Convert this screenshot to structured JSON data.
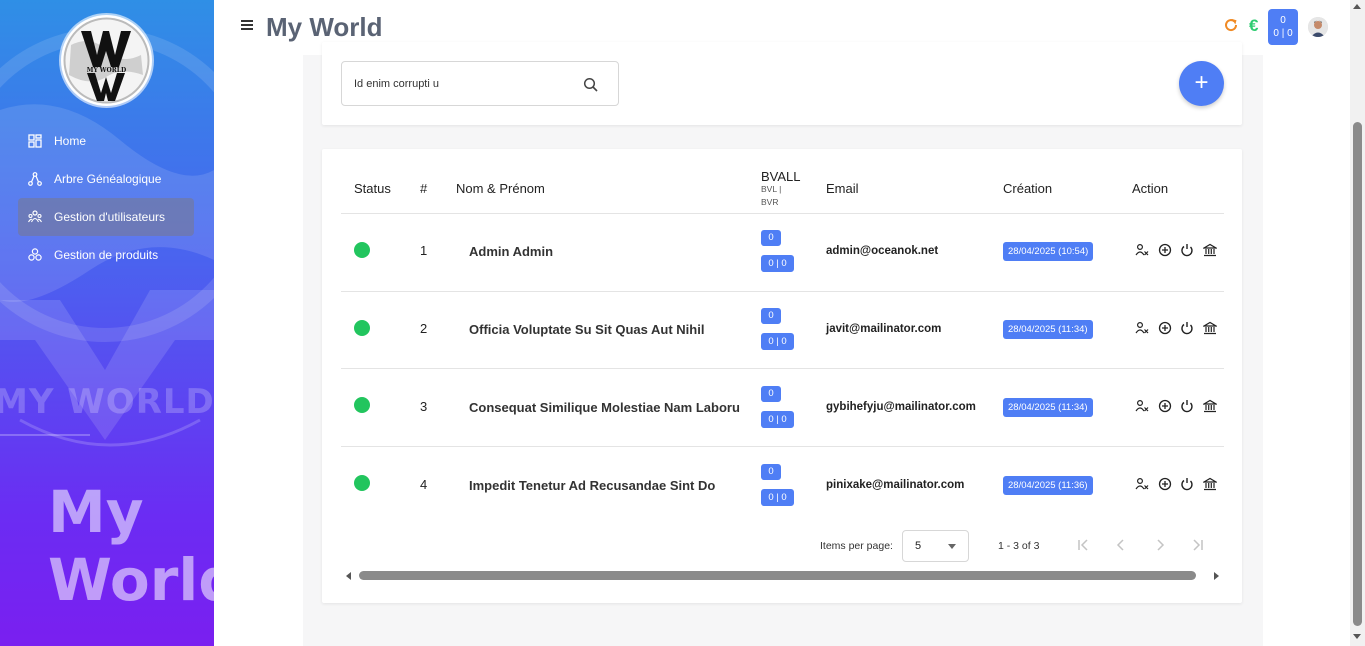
{
  "app": {
    "title": "My World",
    "logo_text": "MY WORLD",
    "logo_initials": "MW",
    "watermark_text": "MY WORLD",
    "watermark_big": [
      "My",
      "World"
    ]
  },
  "sidebar": {
    "items": [
      {
        "label": "Home",
        "icon": "dashboard-icon",
        "active": false
      },
      {
        "label": "Arbre Généalogique",
        "icon": "tree-icon",
        "active": false
      },
      {
        "label": "Gestion d'utilisateurs",
        "icon": "users-icon",
        "active": true
      },
      {
        "label": "Gestion de produits",
        "icon": "products-icon",
        "active": false
      }
    ]
  },
  "topbar": {
    "euro": "€",
    "counter_top": "0",
    "counter_bottom": "0 | 0",
    "icons": [
      "menu-icon",
      "refresh-icon",
      "euro-icon",
      "avatar"
    ]
  },
  "search": {
    "value": "Id enim corrupti u",
    "add_label": "+"
  },
  "table": {
    "headers": {
      "status": "Status",
      "num": "#",
      "name": "Nom & Prénom",
      "bvall": "BVALL",
      "bvall_sub1": "BVL |",
      "bvall_sub2": "BVR",
      "email": "Email",
      "creation": "Création",
      "action": "Action"
    },
    "rows": [
      {
        "num": "1",
        "name": "Admin Admin",
        "bvall": "0",
        "bvlr": "0 | 0",
        "email": "admin@oceanok.net",
        "created": "28/04/2025 (10:54)",
        "status_color": "#22c55e"
      },
      {
        "num": "2",
        "name": "Officia Voluptate Su Sit Quas Aut Nihil",
        "bvall": "0",
        "bvlr": "0 | 0",
        "email": "javit@mailinator.com",
        "created": "28/04/2025 (11:34)",
        "status_color": "#22c55e"
      },
      {
        "num": "3",
        "name": "Consequat Similique Molestiae Nam Laboru",
        "bvall": "0",
        "bvlr": "0 | 0",
        "email": "gybihefyju@mailinator.com",
        "created": "28/04/2025 (11:34)",
        "status_color": "#22c55e"
      },
      {
        "num": "4",
        "name": "Impedit Tenetur Ad Recusandae Sint Do",
        "bvall": "0",
        "bvlr": "0 | 0",
        "email": "pinixake@mailinator.com",
        "created": "28/04/2025 (11:36)",
        "status_color": "#22c55e"
      }
    ],
    "action_icons": [
      "user-remove-icon",
      "add-circle-icon",
      "power-icon",
      "bank-icon"
    ]
  },
  "paginator": {
    "items_per_page_label": "Items per page:",
    "items_per_page": "5",
    "range": "1 - 3 of 3"
  },
  "colors": {
    "accent": "#4f7ef5",
    "status_active": "#22c55e",
    "euro": "#2ecc71",
    "refresh": "#f08a24"
  }
}
